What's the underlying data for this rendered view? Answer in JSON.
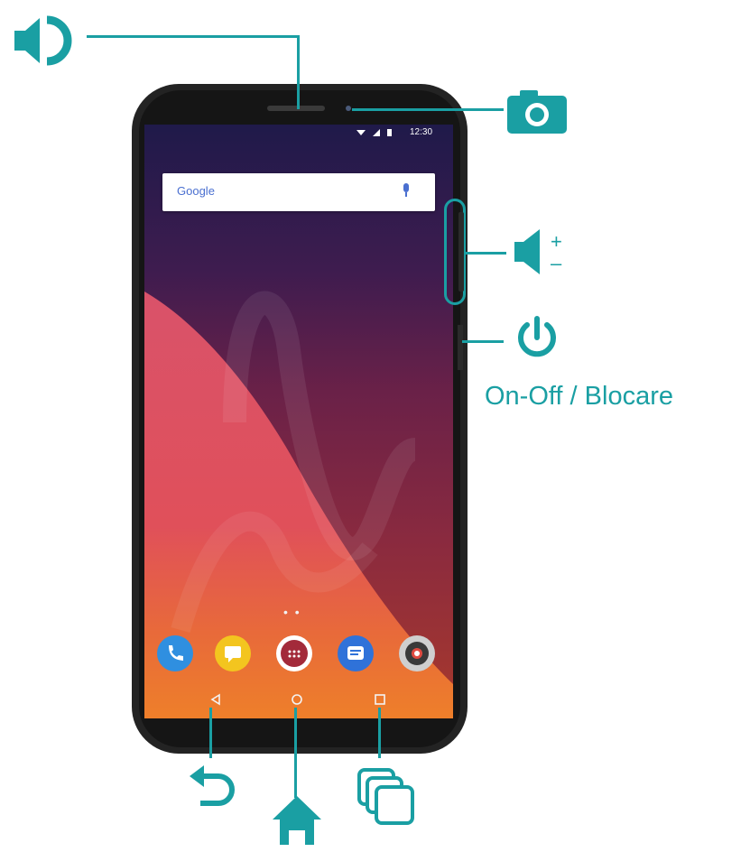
{
  "status_bar": {
    "time": "12:30"
  },
  "search_bar": {
    "logo_text": "Google"
  },
  "home_screen": {
    "page_indicator": "• •",
    "dock_apps": [
      "phone-app",
      "messaging-app",
      "app-drawer",
      "chat-app",
      "camera-app"
    ]
  },
  "nav_bar": {
    "buttons": [
      "back",
      "home",
      "recent-apps"
    ]
  },
  "labels": {
    "power_label": "On-Off / Blocare",
    "volume_plus": "+",
    "volume_minus": "–"
  },
  "colors": {
    "accent": "#1a9fa3"
  }
}
